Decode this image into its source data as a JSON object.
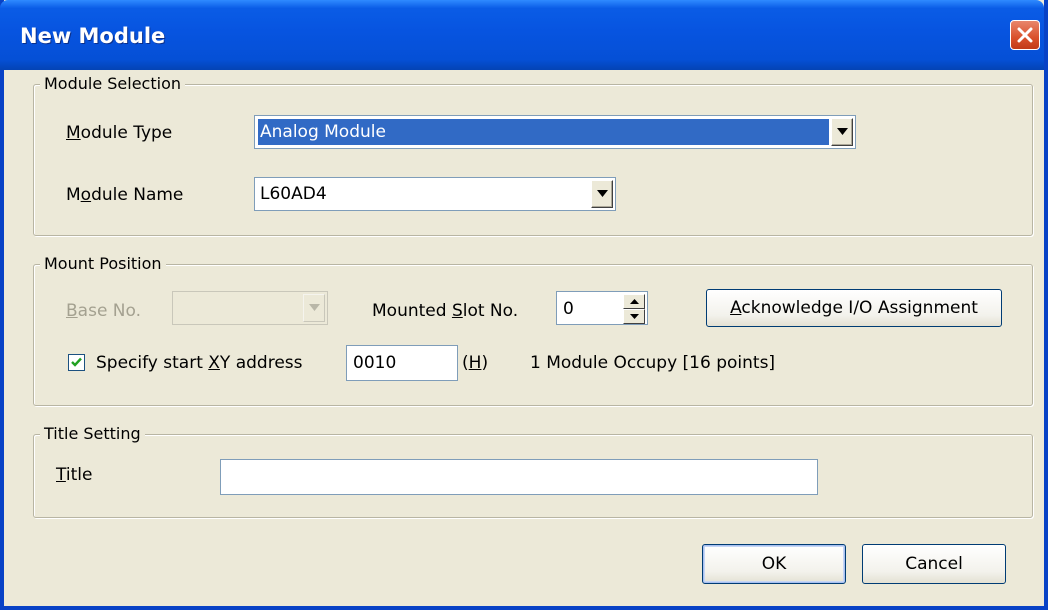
{
  "window": {
    "title": "New Module"
  },
  "module_selection": {
    "group_label": "Module Selection",
    "module_type": {
      "label_pre": "",
      "label_key": "M",
      "label_post": "odule Type",
      "value": "Analog Module"
    },
    "module_name": {
      "label_pre": "M",
      "label_key": "o",
      "label_post": "dule Name",
      "value": "L60AD4"
    }
  },
  "mount_position": {
    "group_label": "Mount Position",
    "base_no": {
      "label_pre": "",
      "label_key": "B",
      "label_post": "ase No.",
      "value": ""
    },
    "slot_no": {
      "label_pre": "Mounted ",
      "label_key": "S",
      "label_post": "lot No.",
      "value": "0"
    },
    "acknowledge_button": {
      "label_pre": "",
      "label_key": "A",
      "label_post": "cknowledge I/O Assignment"
    },
    "start_xy": {
      "checked": true,
      "label_pre": "Specify start ",
      "label_key": "X",
      "label_post": "Y address",
      "value": "0010",
      "unit_pre": "(",
      "unit_key": "H",
      "unit_post": ")",
      "occupy_text": "1 Module Occupy [16 points]"
    }
  },
  "title_setting": {
    "group_label": "Title Setting",
    "title": {
      "label_pre": "",
      "label_key": "T",
      "label_post": "itle",
      "value": ""
    }
  },
  "footer": {
    "ok_label": "OK",
    "cancel_label": "Cancel"
  },
  "colors": {
    "titlebar": "#0754e0",
    "dialog_bg": "#ece9d8",
    "selection": "#316ac5",
    "close_button": "#d9502b"
  },
  "icons": {
    "close": "close-icon",
    "dropdown": "chevron-down-icon",
    "spin_up": "spin-up-icon",
    "spin_down": "spin-down-icon",
    "check": "check-icon"
  }
}
